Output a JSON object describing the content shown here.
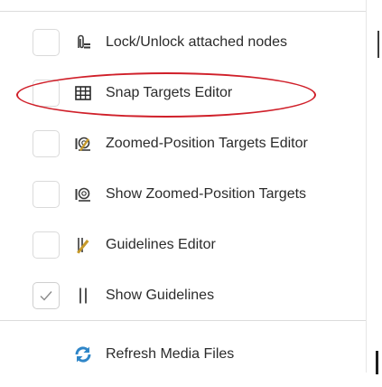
{
  "menu": {
    "items": [
      {
        "label": "Lock/Unlock attached nodes",
        "icon": "paperclip-lock-icon",
        "checked": false,
        "has_checkbox": true
      },
      {
        "label": "Snap Targets Editor",
        "icon": "grid-table-icon",
        "checked": false,
        "has_checkbox": true
      },
      {
        "label": "Zoomed-Position Targets Editor",
        "icon": "zoom-target-edit-icon",
        "checked": false,
        "has_checkbox": true
      },
      {
        "label": "Show Zoomed-Position Targets",
        "icon": "zoom-target-icon",
        "checked": false,
        "has_checkbox": true
      },
      {
        "label": "Guidelines Editor",
        "icon": "guideline-pencil-icon",
        "checked": false,
        "has_checkbox": true
      },
      {
        "label": "Show Guidelines",
        "icon": "vertical-lines-icon",
        "checked": true,
        "has_checkbox": true
      },
      {
        "label": "Refresh Media Files",
        "icon": "refresh-arrows-icon",
        "checked": false,
        "has_checkbox": false
      }
    ],
    "highlighted_item": "Snap Targets Editor"
  },
  "colors": {
    "highlight": "#d0202a",
    "text": "#2b2b2b",
    "refresh_icon": "#2f86c8",
    "guideline_icon": "#c79a2a"
  }
}
